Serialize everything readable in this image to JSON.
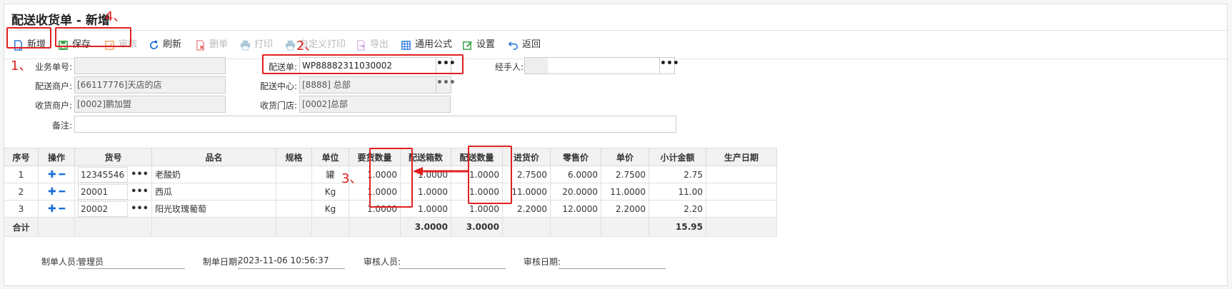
{
  "title": "配送收货单 - 新增",
  "toolbar": [
    {
      "name": "new-button",
      "label": "新增",
      "icon": "new-doc-icon",
      "enabled": true,
      "color": "#1a6fd6"
    },
    {
      "name": "save-button",
      "label": "保存",
      "icon": "save-icon",
      "enabled": true,
      "color": "#2e9e3e"
    },
    {
      "name": "audit-button",
      "label": "审核",
      "icon": "check-icon",
      "enabled": false,
      "color": "#f0a060"
    },
    {
      "name": "refresh-button",
      "label": "刷新",
      "icon": "refresh-icon",
      "enabled": true,
      "color": "#1a6fd6"
    },
    {
      "name": "delete-button",
      "label": "删单",
      "icon": "delete-doc-icon",
      "enabled": false,
      "color": "#e05050"
    },
    {
      "name": "print-button",
      "label": "打印",
      "icon": "print-icon",
      "enabled": false,
      "color": "#8ab"
    },
    {
      "name": "custom-print-button",
      "label": "自定义打印",
      "icon": "print-icon",
      "enabled": false,
      "color": "#8ab"
    },
    {
      "name": "export-button",
      "label": "导出",
      "icon": "export-icon",
      "enabled": false,
      "color": "#c9a0e0"
    },
    {
      "name": "formula-button",
      "label": "通用公式",
      "icon": "grid-icon",
      "enabled": true,
      "color": "#1a6fd6"
    },
    {
      "name": "settings-button",
      "label": "设置",
      "icon": "edit-settings-icon",
      "enabled": true,
      "color": "#2e9e3e"
    },
    {
      "name": "back-button",
      "label": "返回",
      "icon": "back-arrow-icon",
      "enabled": true,
      "color": "#1a6fd6"
    }
  ],
  "form": {
    "biz_no_label": "业务单号:",
    "biz_no_value": "",
    "delivery_no_label": "配送单:",
    "delivery_no_value": "WP88882311030002",
    "handler_label": "经手人:",
    "handler_value": "",
    "merchant_label": "配送商户:",
    "merchant_value": "[66117776]天店的店",
    "center_label": "配送中心:",
    "center_value": "[8888] 总部",
    "receiver_label": "收货商户:",
    "receiver_value": "[0002]鹏加盟",
    "store_label": "收货门店:",
    "store_value": "[0002]总部",
    "remark_label": "备注:",
    "remark_value": ""
  },
  "table": {
    "headers": [
      "序号",
      "操作",
      "货号",
      "品名",
      "规格",
      "单位",
      "要货数量",
      "配送箱数",
      "配送数量",
      "进货价",
      "零售价",
      "单价",
      "小计金额",
      "生产日期"
    ],
    "rows": [
      {
        "seq": "1",
        "op_add": "✚",
        "op_remove": "━",
        "code": "12345546",
        "name": "老酸奶",
        "spec": "",
        "unit": "罐",
        "req_qty": "1.0000",
        "boxes": "1.0000",
        "qty": "1.0000",
        "cost": "2.7500",
        "retail": "6.0000",
        "price": "2.7500",
        "subtotal": "2.75",
        "date": ""
      },
      {
        "seq": "2",
        "op_add": "✚",
        "op_remove": "━",
        "code": "20001",
        "name": "西瓜",
        "spec": "",
        "unit": "Kg",
        "req_qty": "1.0000",
        "boxes": "1.0000",
        "qty": "1.0000",
        "cost": "11.0000",
        "retail": "20.0000",
        "price": "11.0000",
        "subtotal": "11.00",
        "date": ""
      },
      {
        "seq": "3",
        "op_add": "✚",
        "op_remove": "━",
        "code": "20002",
        "name": "阳光玫瑰葡萄",
        "spec": "",
        "unit": "Kg",
        "req_qty": "1.0000",
        "boxes": "1.0000",
        "qty": "1.0000",
        "cost": "2.2000",
        "retail": "12.0000",
        "price": "2.2000",
        "subtotal": "2.20",
        "date": ""
      }
    ],
    "total_label": "合计",
    "total_boxes": "3.0000",
    "total_qty": "3.0000",
    "total_amount": "15.95"
  },
  "footer": {
    "creator_label": "制单人员:",
    "creator_value": "管理员",
    "create_date_label": "制单日期:",
    "create_date_value": "2023-11-06 10:56:37",
    "auditor_label": "审核人员:",
    "auditor_value": "",
    "audit_date_label": "审核日期:",
    "audit_date_value": ""
  },
  "annotations": {
    "n1": "1、",
    "n2": "2、",
    "n3": "3、",
    "n4": "4、"
  },
  "dots_glyph": "•••"
}
